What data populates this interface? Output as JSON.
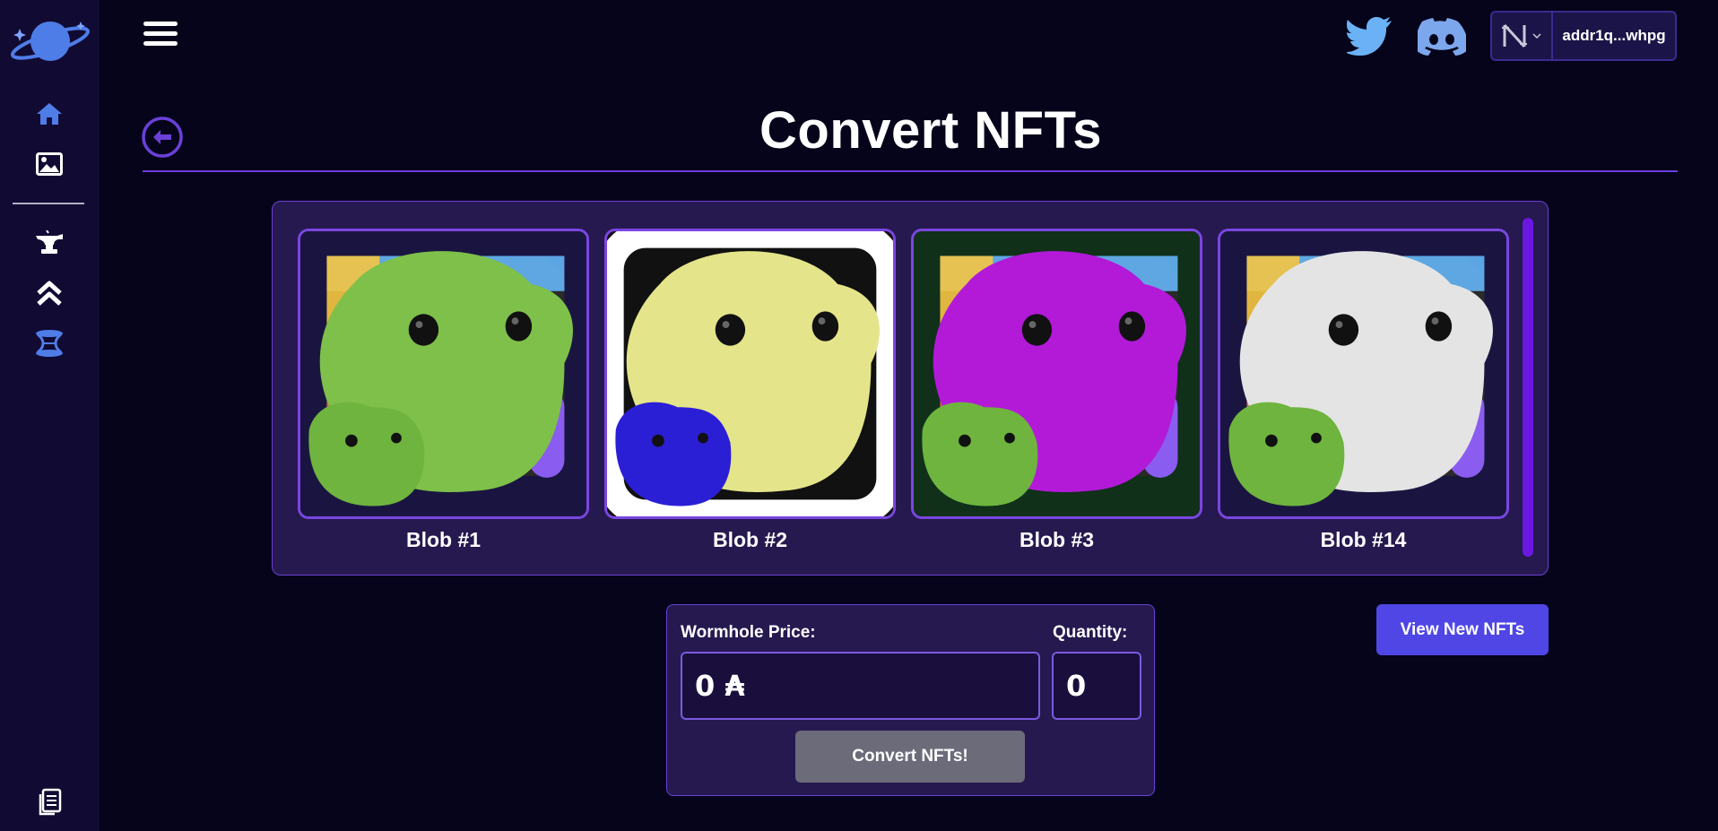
{
  "sidebar": {
    "logo_icon": "planet-logo",
    "items": [
      {
        "icon": "home-icon"
      },
      {
        "icon": "image-icon"
      },
      {
        "icon": "anvil-icon"
      },
      {
        "icon": "upgrade-chevrons-icon"
      },
      {
        "icon": "wormhole-icon"
      }
    ],
    "footer_icon": "documents-icon"
  },
  "header": {
    "menu_icon": "hamburger-icon",
    "social": [
      "twitter-icon",
      "discord-icon"
    ],
    "wallet": {
      "provider_icon": "nami-icon",
      "address": "addr1q...whpg"
    }
  },
  "page": {
    "title": "Convert NFTs"
  },
  "gallery": {
    "cards": [
      {
        "name": "Blob #1",
        "color": "#7ec04a",
        "small_color": "#6fb43e",
        "bg": "#1a1540"
      },
      {
        "name": "Blob #2",
        "color": "#e4e48a",
        "small_color": "#2b1fd6",
        "bg": "#ffffff"
      },
      {
        "name": "Blob #3",
        "color": "#b21ad8",
        "small_color": "#6fb43e",
        "bg": "#10301a"
      },
      {
        "name": "Blob #14",
        "color": "#e4e4e4",
        "small_color": "#6fb43e",
        "bg": "#1a1540"
      }
    ]
  },
  "convert": {
    "price_label": "Wormhole Price:",
    "price_value": "0 ₳",
    "quantity_label": "Quantity:",
    "quantity_value": "0",
    "button": "Convert NFTs!"
  },
  "view_button": "View New NFTs",
  "colors": {
    "accent": "#6a40d8",
    "button_blue": "#4f46e5",
    "icon_blue": "#4f7de8",
    "panel": "#26194f"
  }
}
